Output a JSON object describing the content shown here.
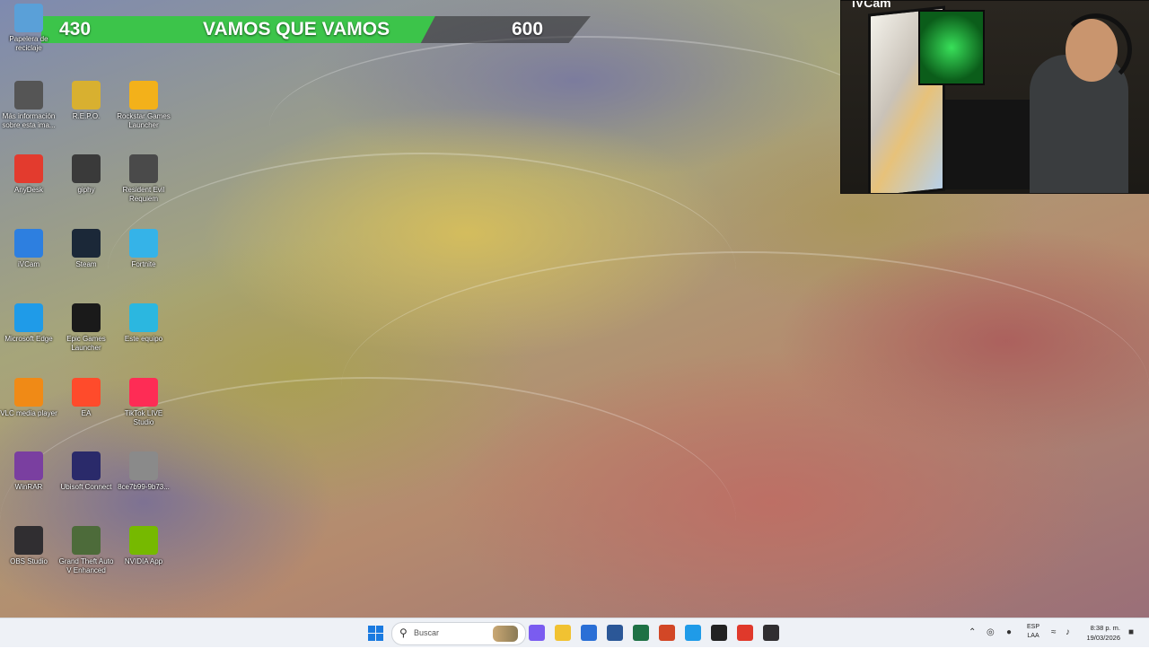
{
  "overlay": {
    "current_value": "430",
    "goal_text": "VAMOS QUE VAMOS",
    "goal_value": "600",
    "progress_fraction": 0.717,
    "fill_color": "#3cc44a"
  },
  "webcam": {
    "label": "iVCam"
  },
  "desktop_icons": [
    {
      "key": "recycle",
      "label": "Papelera de reciclaje",
      "icon": "recycle-bin-icon",
      "color": "#5aa0d8"
    },
    {
      "key": "info",
      "label": "Más información sobre esta ima...",
      "icon": "camera-info-icon",
      "color": "#555"
    },
    {
      "key": "repo",
      "label": "R.E.P.O.",
      "icon": "repo-game-icon",
      "color": "#d8b030"
    },
    {
      "key": "rockstar",
      "label": "Rockstar Games Launcher",
      "icon": "rockstar-icon",
      "color": "#f3b11a"
    },
    {
      "key": "anydesk",
      "label": "AnyDesk",
      "icon": "anydesk-icon",
      "color": "#e33b2e"
    },
    {
      "key": "giphy",
      "label": "giphy",
      "icon": "giphy-icon",
      "color": "#3a3a3a"
    },
    {
      "key": "resident",
      "label": "Resident Evil Requiem",
      "icon": "resident-evil-icon",
      "color": "#4a4a4a"
    },
    {
      "key": "ivcam",
      "label": "iVCam",
      "icon": "ivcam-icon",
      "color": "#2d7fe0"
    },
    {
      "key": "steam",
      "label": "Steam",
      "icon": "steam-icon",
      "color": "#1b2838"
    },
    {
      "key": "fortnite",
      "label": "Fortnite",
      "icon": "fortnite-icon",
      "color": "#35b3e8"
    },
    {
      "key": "edge",
      "label": "Microsoft Edge",
      "icon": "edge-icon",
      "color": "#1f9be8"
    },
    {
      "key": "epic",
      "label": "Epic Games Launcher",
      "icon": "epic-games-icon",
      "color": "#1a1a1a"
    },
    {
      "key": "thispc",
      "label": "Este equipo",
      "icon": "computer-icon",
      "color": "#2bb7e0"
    },
    {
      "key": "vlc",
      "label": "VLC media player",
      "icon": "vlc-icon",
      "color": "#f08a16"
    },
    {
      "key": "ea",
      "label": "EA",
      "icon": "ea-icon",
      "color": "#ff4b2b"
    },
    {
      "key": "tiktok",
      "label": "TikTok LIVE Studio",
      "icon": "tiktok-icon",
      "color": "#fe2c55"
    },
    {
      "key": "winrar",
      "label": "WinRAR",
      "icon": "winrar-icon",
      "color": "#7a3fa0"
    },
    {
      "key": "ubisoft",
      "label": "Ubisoft Connect",
      "icon": "ubisoft-icon",
      "color": "#2a2a6a"
    },
    {
      "key": "file",
      "label": "8ce7b99-9b73...",
      "icon": "file-icon",
      "color": "#8a8a8a"
    },
    {
      "key": "obs",
      "label": "OBS Studio",
      "icon": "obs-icon",
      "color": "#302e31"
    },
    {
      "key": "gta",
      "label": "Grand Theft Auto V Enhanced",
      "icon": "gta-icon",
      "color": "#4d6b3a"
    },
    {
      "key": "nvidia",
      "label": "NVIDIA App",
      "icon": "nvidia-icon",
      "color": "#76b900"
    }
  ],
  "taskbar": {
    "search_placeholder": "Buscar",
    "apps": [
      {
        "name": "copilot-icon",
        "color": "#7a5cf0"
      },
      {
        "name": "file-explorer-icon",
        "color": "#f1c232"
      },
      {
        "name": "store-icon",
        "color": "#2a6fd6"
      },
      {
        "name": "word-icon",
        "color": "#2b5797"
      },
      {
        "name": "excel-icon",
        "color": "#1e7145"
      },
      {
        "name": "powerpoint-icon",
        "color": "#d24726"
      },
      {
        "name": "edge-icon",
        "color": "#1f9be8"
      },
      {
        "name": "game-icon",
        "color": "#222"
      },
      {
        "name": "chrome-icon",
        "color": "#e0392b"
      },
      {
        "name": "obs-icon",
        "color": "#302e31"
      }
    ],
    "language_line1": "ESP",
    "language_line2": "LAA",
    "time": "8:38 p. m.",
    "date": "19/03/2026"
  }
}
